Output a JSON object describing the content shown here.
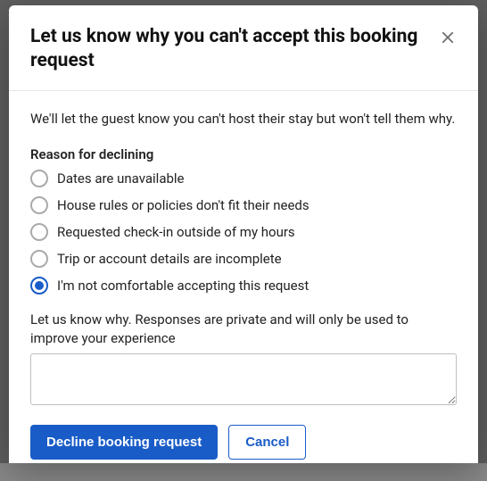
{
  "modal": {
    "title": "Let us know why you can't accept this booking request",
    "intro": "We'll let the guest know you can't host their stay but won't tell them why.",
    "reason_label": "Reason for declining",
    "reasons": [
      {
        "label": "Dates are unavailable",
        "selected": false
      },
      {
        "label": "House rules or policies don't fit their needs",
        "selected": false
      },
      {
        "label": "Requested check-in outside of my hours",
        "selected": false
      },
      {
        "label": "Trip or account details are incomplete",
        "selected": false
      },
      {
        "label": "I'm not comfortable accepting this request",
        "selected": true
      }
    ],
    "textarea_label": "Let us know why. Responses are private and will only be used to improve your experience",
    "textarea_value": "",
    "decline_label": "Decline booking request",
    "cancel_label": "Cancel"
  }
}
